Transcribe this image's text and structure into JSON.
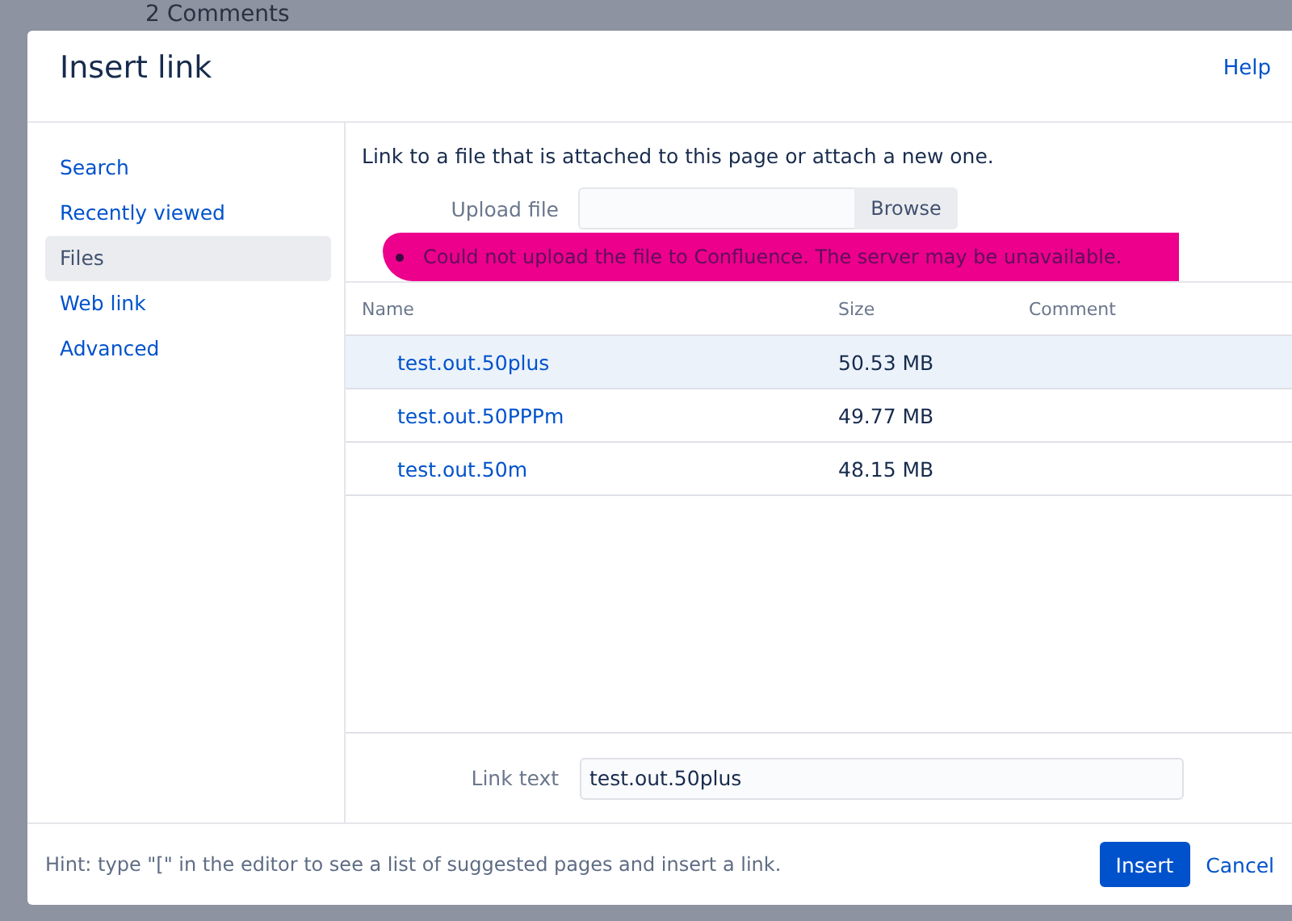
{
  "background": {
    "heading": "2 Comments"
  },
  "dialog": {
    "title": "Insert link",
    "help": "Help"
  },
  "sidebar": {
    "items": [
      {
        "label": "Search",
        "selected": false
      },
      {
        "label": "Recently viewed",
        "selected": false
      },
      {
        "label": "Files",
        "selected": true
      },
      {
        "label": "Web link",
        "selected": false
      },
      {
        "label": "Advanced",
        "selected": false
      }
    ]
  },
  "intro": "Link to a file that is attached to this page or attach a new one.",
  "upload": {
    "label": "Upload file",
    "button": "Browse"
  },
  "error": "Could not upload the file to Confluence. The server may be unavailable.",
  "table": {
    "columns": [
      "Name",
      "Size",
      "Comment"
    ],
    "rows": [
      {
        "name": "test.out.50plus",
        "size": "50.53 MB",
        "selected": true
      },
      {
        "name": "test.out.50PPPm",
        "size": "49.77 MB",
        "selected": false
      },
      {
        "name": "test.out.50m",
        "size": "48.15 MB",
        "selected": false
      }
    ]
  },
  "link_text": {
    "label": "Link text",
    "value": "test.out.50plus"
  },
  "footer": {
    "hint": "Hint: type \"[\" in the editor to see a list of suggested pages and insert a link.",
    "insert": "Insert",
    "cancel": "Cancel"
  }
}
